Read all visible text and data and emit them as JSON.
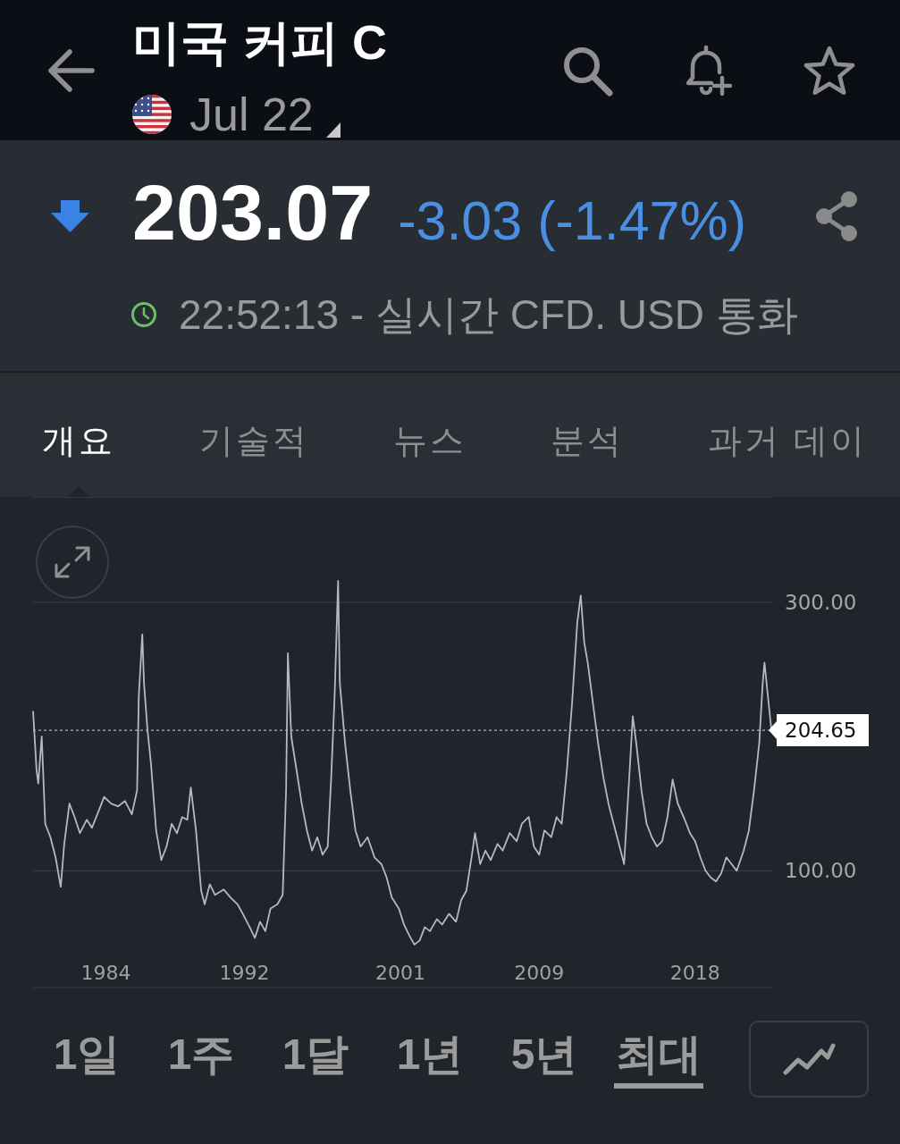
{
  "header": {
    "title": "미국 커피 C",
    "contract": "Jul 22"
  },
  "quote": {
    "falling": true,
    "price": "203.07",
    "change": "-3.03 (-1.47%)",
    "status_text": "22:52:13 - 실시간 CFD. USD 통화"
  },
  "tabs": [
    {
      "label": "개요",
      "selected": true
    },
    {
      "label": "기술적",
      "selected": false
    },
    {
      "label": "뉴스",
      "selected": false
    },
    {
      "label": "분석",
      "selected": false
    },
    {
      "label": "과거 데이",
      "selected": false
    }
  ],
  "chart": {
    "chart_data": {
      "type": "line",
      "xlim": [
        1979.8,
        2022.6
      ],
      "ylim": [
        13,
        378
      ],
      "x": [
        1979.8,
        1980.0,
        1980.1,
        1980.3,
        1980.5,
        1980.8,
        1981.1,
        1981.3,
        1981.4,
        1981.6,
        1981.9,
        1982.2,
        1982.5,
        1982.9,
        1983.2,
        1983.6,
        1983.9,
        1984.3,
        1984.7,
        1985.1,
        1985.5,
        1985.8,
        1985.9,
        1986.1,
        1986.2,
        1986.4,
        1986.6,
        1986.9,
        1987.2,
        1987.5,
        1987.8,
        1988.1,
        1988.4,
        1988.7,
        1988.9,
        1989.2,
        1989.5,
        1989.7,
        1990.0,
        1990.3,
        1990.8,
        1991.2,
        1991.6,
        1991.9,
        1992.3,
        1992.6,
        1992.9,
        1993.2,
        1993.5,
        1993.9,
        1994.2,
        1994.4,
        1994.5,
        1994.7,
        1995.0,
        1995.3,
        1995.6,
        1995.9,
        1996.2,
        1996.5,
        1996.8,
        1997.0,
        1997.2,
        1997.4,
        1997.5,
        1997.8,
        1998.1,
        1998.4,
        1998.7,
        1999.1,
        1999.5,
        1999.9,
        2000.2,
        2000.5,
        2000.9,
        2001.2,
        2001.5,
        2001.8,
        2002.1,
        2002.4,
        2002.7,
        2003.1,
        2003.4,
        2003.8,
        2004.2,
        2004.5,
        2004.8,
        2005.1,
        2005.3,
        2005.6,
        2005.9,
        2006.2,
        2006.6,
        2006.9,
        2007.3,
        2007.7,
        2008.0,
        2008.4,
        2008.7,
        2009.0,
        2009.3,
        2009.7,
        2010.0,
        2010.3,
        2010.6,
        2010.9,
        2011.2,
        2011.4,
        2011.6,
        2011.8,
        2012.1,
        2012.4,
        2012.7,
        2013.0,
        2013.3,
        2013.6,
        2013.9,
        2014.2,
        2014.4,
        2014.6,
        2014.9,
        2015.2,
        2015.5,
        2015.8,
        2016.1,
        2016.4,
        2016.7,
        2017.0,
        2017.4,
        2017.7,
        2018.0,
        2018.3,
        2018.6,
        2018.9,
        2019.2,
        2019.5,
        2019.8,
        2020.1,
        2020.4,
        2020.8,
        2021.1,
        2021.4,
        2021.7,
        2021.9,
        2022.0,
        2022.2,
        2022.4
      ],
      "series": [
        {
          "color": "#b4bac4",
          "values": [
            219,
            175,
            165,
            200,
            135,
            125,
            110,
            95,
            88,
            120,
            150,
            140,
            128,
            138,
            132,
            145,
            155,
            150,
            148,
            152,
            142,
            160,
            230,
            276,
            240,
            205,
            180,
            130,
            108,
            118,
            135,
            128,
            140,
            138,
            162,
            130,
            85,
            75,
            90,
            82,
            86,
            80,
            75,
            68,
            58,
            50,
            62,
            55,
            72,
            75,
            82,
            160,
            262,
            200,
            175,
            150,
            130,
            115,
            125,
            112,
            118,
            170,
            230,
            316,
            240,
            195,
            160,
            130,
            118,
            125,
            110,
            105,
            95,
            80,
            72,
            60,
            52,
            45,
            48,
            58,
            55,
            64,
            60,
            68,
            62,
            78,
            85,
            110,
            128,
            105,
            115,
            108,
            120,
            115,
            128,
            122,
            135,
            140,
            118,
            112,
            130,
            125,
            140,
            135,
            175,
            225,
            285,
            305,
            270,
            255,
            225,
            195,
            170,
            150,
            135,
            120,
            105,
            170,
            215,
            195,
            160,
            135,
            125,
            118,
            122,
            140,
            168,
            150,
            138,
            128,
            122,
            110,
            100,
            95,
            92,
            98,
            110,
            105,
            100,
            115,
            130,
            160,
            195,
            240,
            255,
            230,
            205
          ]
        }
      ],
      "xticks": [
        1984,
        1992,
        2001,
        2009,
        2018
      ],
      "yticks": [
        {
          "value": 100,
          "label": "100.00"
        },
        {
          "value": 300,
          "label": "300.00"
        }
      ],
      "ref_lines": [
        {
          "axis": "y",
          "value": 204.65,
          "label": "204.65"
        }
      ]
    }
  },
  "ranges": [
    {
      "label": "1일",
      "selected": false
    },
    {
      "label": "1주",
      "selected": false
    },
    {
      "label": "1달",
      "selected": false
    },
    {
      "label": "1년",
      "selected": false
    },
    {
      "label": "5년",
      "selected": false
    },
    {
      "label": "최대",
      "selected": true
    }
  ]
}
